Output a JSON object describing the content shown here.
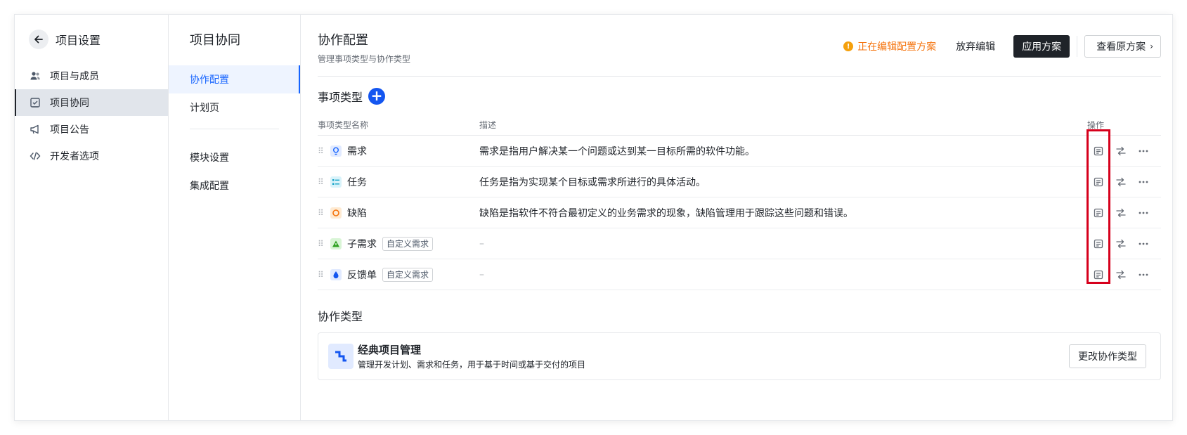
{
  "sidebar": {
    "title": "项目设置",
    "items": [
      {
        "label": "项目与成员",
        "icon": "members-icon",
        "active": false
      },
      {
        "label": "项目协同",
        "icon": "collab-check-icon",
        "active": true
      },
      {
        "label": "项目公告",
        "icon": "megaphone-icon",
        "active": false
      },
      {
        "label": "开发者选项",
        "icon": "code-icon",
        "active": false
      }
    ]
  },
  "subnav": {
    "title": "项目协同",
    "items": [
      {
        "label": "协作配置",
        "active": true
      },
      {
        "label": "计划页",
        "active": false
      },
      {
        "label": "模块设置",
        "active": false
      },
      {
        "label": "集成配置",
        "active": false
      }
    ]
  },
  "header": {
    "title": "协作配置",
    "subtitle": "管理事项类型与协作类型",
    "editing_status": "正在编辑配置方案",
    "discard_label": "放弃编辑",
    "apply_label": "应用方案",
    "view_label": "查看原方案"
  },
  "item_types": {
    "title": "事项类型",
    "columns": {
      "name": "事项类型名称",
      "desc": "描述",
      "ops": "操作"
    },
    "rows": [
      {
        "name": "需求",
        "tag": "",
        "desc": "需求是指用户解决某一个问题或达到某一目标所需的软件功能。",
        "icon": "bulb-icon",
        "icon_color": "#1664ff",
        "icon_bg": "#e1eaff"
      },
      {
        "name": "任务",
        "tag": "",
        "desc": "任务是指为实现某个目标或需求所进行的具体活动。",
        "icon": "task-list-icon",
        "icon_color": "#14a3c7",
        "icon_bg": "#d9f3fa"
      },
      {
        "name": "缺陷",
        "tag": "",
        "desc": "缺陷是指软件不符合最初定义的业务需求的现象，缺陷管理用于跟踪这些问题和错误。",
        "icon": "bug-circle-icon",
        "icon_color": "#f5730c",
        "icon_bg": "#feead2"
      },
      {
        "name": "子需求",
        "tag": "自定义需求",
        "desc": "–",
        "icon": "triangle-icon",
        "icon_color": "#2ea121",
        "icon_bg": "#d9f5d6"
      },
      {
        "name": "反馈单",
        "tag": "自定义需求",
        "desc": "–",
        "icon": "drop-icon",
        "icon_color": "#1456f0",
        "icon_bg": "#e1eaff"
      }
    ]
  },
  "collab_types": {
    "title": "协作类型",
    "card": {
      "name": "经典项目管理",
      "desc": "管理开发计划、需求和任务，用于基于时间或基于交付的项目",
      "change_label": "更改协作类型"
    }
  },
  "colors": {
    "accent": "#1664ff",
    "primary_dark": "#1f2329",
    "warning": "#f5730c",
    "highlight": "#d6001c"
  }
}
